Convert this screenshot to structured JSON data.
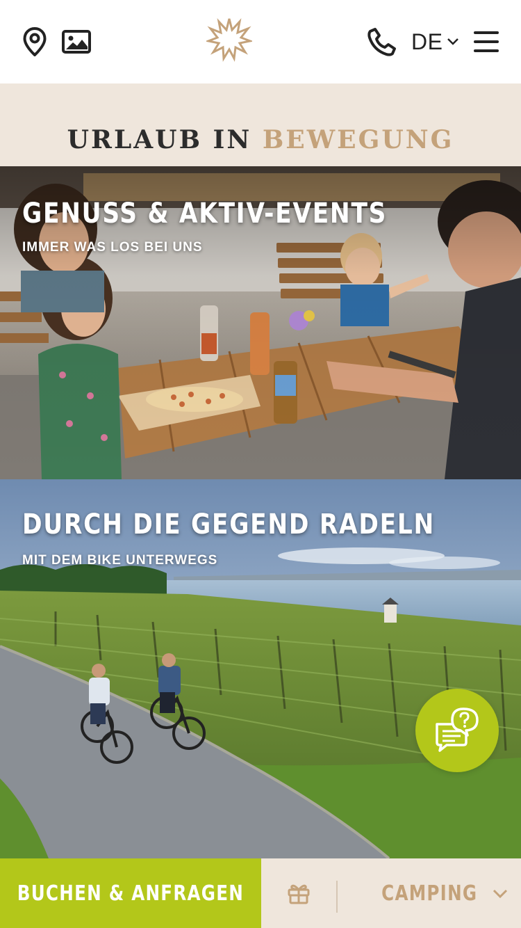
{
  "header": {
    "icons": {
      "location": "map-pin-icon",
      "gallery": "image-icon",
      "logo": "sun-logo",
      "phone": "phone-icon",
      "menu": "hamburger-menu-icon",
      "lang_chevron": "chevron-down-icon"
    },
    "language": "DE"
  },
  "banner": {
    "title_part1": "URLAUB IN",
    "title_part2": "BEWEGUNG"
  },
  "tiles": [
    {
      "heading": "GENUSS & AKTIV-EVENTS",
      "subheading": "IMMER WAS LOS BEI UNS"
    },
    {
      "heading": "DURCH DIE GEGEND RADELN",
      "subheading": "MIT DEM BIKE UNTERWEGS"
    }
  ],
  "chat": {
    "icon": "chat-question-icon"
  },
  "bottom_bar": {
    "book_label": "BUCHEN & ANFRAGEN",
    "gift_icon": "gift-icon",
    "select_value": "CAMPING",
    "select_icon": "chevron-down-icon"
  },
  "colors": {
    "accent_green": "#b3c71a",
    "accent_tan": "#c4a27a",
    "band_beige": "#efe6dc",
    "text_dark": "#2c2c2c"
  }
}
